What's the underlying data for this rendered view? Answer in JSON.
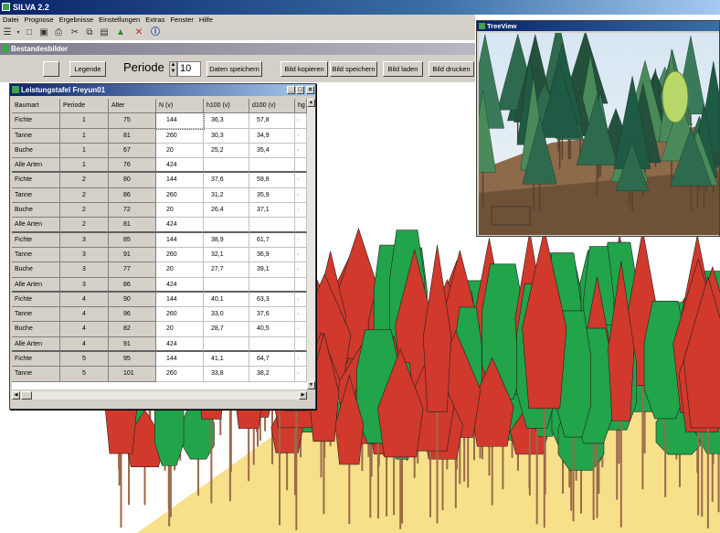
{
  "app": {
    "title": "SILVA 2.2"
  },
  "menu": [
    "Datei",
    "Prognose",
    "Ergebnisse",
    "Einstellungen",
    "Extras",
    "Fenster",
    "Hilfe"
  ],
  "toolbar_icons": [
    "open-icon",
    "dropdown-icon",
    "new-icon",
    "save-icon",
    "print-icon",
    "cut-icon",
    "copy-icon",
    "paste-icon",
    "tree-icon",
    "delete-icon",
    "help-icon"
  ],
  "bestand": {
    "title": "Bestandesbilder",
    "buttons": {
      "legende": "Legende",
      "daten_speichern": "Daten speichern",
      "bild_kopieren": "Bild kopieren",
      "bild_speichern": "Bild speichern",
      "bild_laden": "Bild laden",
      "bild_drucken": "Bild drucken"
    },
    "periode_label": "Periode",
    "periode_value": "10"
  },
  "table": {
    "title": "Leistungstafel Freyun01",
    "headers": [
      "Baumart",
      "Periode",
      "Alter",
      "N (v)",
      "h100 (v)",
      "d100 (v)",
      "hg"
    ],
    "rows": [
      [
        "Fichte",
        "1",
        "75",
        "144",
        "36,3",
        "57,8",
        "·"
      ],
      [
        "Tanne",
        "1",
        "81",
        "260",
        "30,3",
        "34,9",
        "·"
      ],
      [
        "Buche",
        "1",
        "67",
        "20",
        "25,2",
        "35,4",
        "·"
      ],
      [
        "Alle Arten",
        "1",
        "76",
        "424",
        "",
        "",
        ""
      ],
      [
        "Fichte",
        "2",
        "80",
        "144",
        "37,6",
        "59,8",
        "·"
      ],
      [
        "Tanne",
        "2",
        "86",
        "260",
        "31,2",
        "35,9",
        "·"
      ],
      [
        "Buche",
        "2",
        "72",
        "20",
        "26,4",
        "37,1",
        "·"
      ],
      [
        "Alle Arten",
        "2",
        "81",
        "424",
        "",
        "",
        ""
      ],
      [
        "Fichte",
        "3",
        "85",
        "144",
        "38,9",
        "61,7",
        "·"
      ],
      [
        "Tanne",
        "3",
        "91",
        "260",
        "32,1",
        "36,9",
        "·"
      ],
      [
        "Buche",
        "3",
        "77",
        "20",
        "27,7",
        "39,1",
        "·"
      ],
      [
        "Alle Arten",
        "3",
        "86",
        "424",
        "",
        "",
        ""
      ],
      [
        "Fichte",
        "4",
        "90",
        "144",
        "40,1",
        "63,3",
        "·"
      ],
      [
        "Tanne",
        "4",
        "96",
        "260",
        "33,0",
        "37,6",
        "·"
      ],
      [
        "Buche",
        "4",
        "82",
        "20",
        "28,7",
        "40,5",
        "·"
      ],
      [
        "Alle Arten",
        "4",
        "91",
        "424",
        "",
        "",
        ""
      ],
      [
        "Fichte",
        "5",
        "95",
        "144",
        "41,1",
        "64,7",
        "·"
      ],
      [
        "Tanne",
        "5",
        "101",
        "260",
        "33,8",
        "38,2",
        "·"
      ]
    ]
  },
  "treeview": {
    "title": "TreeView"
  },
  "colors": {
    "spruce": "#d0392b",
    "broadleaf": "#21a44a",
    "ground": "#f7e08a",
    "trunk": "#9b6a4a"
  }
}
